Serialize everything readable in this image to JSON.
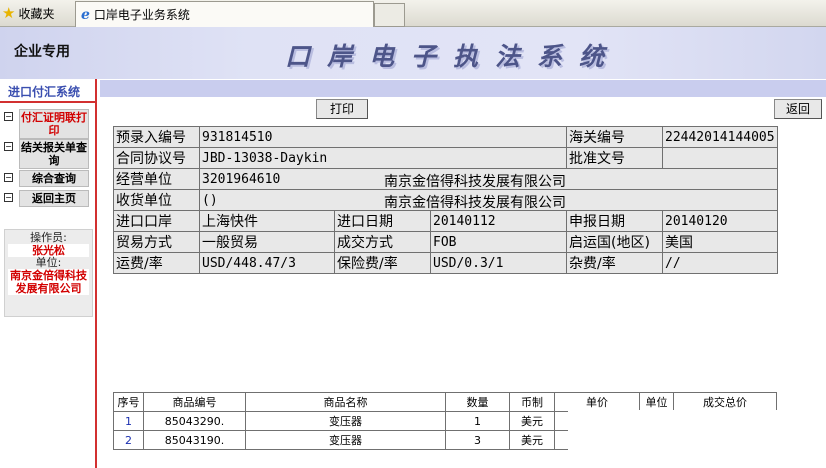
{
  "browser": {
    "favorites_label": "收藏夹",
    "tab_title": "口岸电子业务系统"
  },
  "header": {
    "left_label": "企业专用",
    "title": "口岸电子执法系统"
  },
  "sidebar": {
    "system_title": "进口付汇系统",
    "menu": [
      {
        "label": "付汇证明联打印"
      },
      {
        "label": "结关报关单查询"
      },
      {
        "label": "综合查询"
      },
      {
        "label": "返回主页"
      }
    ],
    "operator_label": "操作员:",
    "operator_name": "张光松",
    "unit_label": "单位:",
    "unit_name": "南京金倍得科技发展有限公司"
  },
  "toolbar": {
    "print_label": "打印",
    "back_label": "返回"
  },
  "info": {
    "pre_entry_no_label": "预录入编号",
    "pre_entry_no": "931814510",
    "customs_no_label": "海关编号",
    "customs_no": "22442014144005",
    "contract_no_label": "合同协议号",
    "contract_no": "JBD-13038-Daykin",
    "approval_no_label": "批准文号",
    "approval_no": "",
    "operating_unit_label": "经营单位",
    "operating_unit_code": "3201964610",
    "operating_unit_name": "南京金倍得科技发展有限公司",
    "consignee_label": "收货单位",
    "consignee_code": "()",
    "consignee_name": "南京金倍得科技发展有限公司",
    "import_port_label": "进口口岸",
    "import_port": "上海快件",
    "import_date_label": "进口日期",
    "import_date": "20140112",
    "declare_date_label": "申报日期",
    "declare_date": "20140120",
    "trade_mode_label": "贸易方式",
    "trade_mode": "一般贸易",
    "deal_mode_label": "成交方式",
    "deal_mode": "FOB",
    "origin_country_label": "启运国(地区)",
    "origin_country": "美国",
    "freight_label": "运费/率",
    "freight": "USD/448.47/3",
    "insurance_label": "保险费/率",
    "insurance": "USD/0.3/1",
    "misc_fee_label": "杂费/率",
    "misc_fee": "//"
  },
  "goods": {
    "headers": [
      "序号",
      "商品编号",
      "商品名称",
      "数量",
      "币制",
      "单价",
      "单位",
      "成交总价"
    ],
    "rows": [
      {
        "seq": "1",
        "code": "85043290.",
        "name": "变压器",
        "qty": "1",
        "currency": "美元"
      },
      {
        "seq": "2",
        "code": "85043190.",
        "name": "变压器",
        "qty": "3",
        "currency": "美元"
      }
    ]
  }
}
